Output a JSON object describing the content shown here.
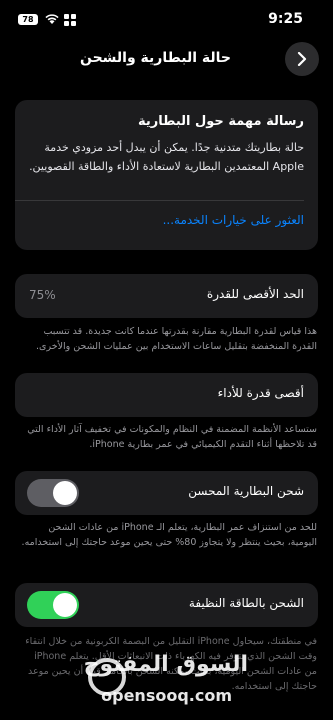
{
  "status_bar": {
    "time": "9:25",
    "battery_level": "78"
  },
  "nav": {
    "title": "حالة البطارية والشحن"
  },
  "message_card": {
    "title": "رسالة مهمة حول البطارية",
    "body": "حالة بطاريتك متدنية جدًا. يمكن أن يبدل أحد مزودي خدمة Apple المعتمدين البطارية لاستعادة الأداء والطاقة القصويين.",
    "link": "العثور على خيارات الخدمة..."
  },
  "max_capacity": {
    "label": "الحد الأقصى للقدرة",
    "value": "75%",
    "footnote": "هذا قياس لقدرة البطارية مقارنة بقدرتها عندما كانت جديدة. قد تتسبب القدرة المنخفضة بتقليل ساعات الاستخدام بين عمليات الشحن والأخرى."
  },
  "peak_performance": {
    "label": "أقصى قدرة للأداء",
    "footnote": "ستساعد الأنظمة المضمنة في النظام والمكونات في تخفيف آثار الأداء التي قد تلاحظها أثناء التقدم الكيميائي في عمر بطارية iPhone."
  },
  "optimized_charging": {
    "label": "شحن البطارية المحسن",
    "enabled": false,
    "footnote": "للحد من استنزاف عمر البطارية، يتعلم الـ iPhone من عادات الشحن اليومية، بحيث ينتظر ولا يتجاوز 80% حتى يحين موعد حاجتك إلى استخدامه."
  },
  "clean_energy_charging": {
    "label": "الشحن بالطاقة النظيفة",
    "enabled": true,
    "footnote": "في منطقتك، سيحاول iPhone التقليل من البصمة الكربونية من خلال انتقاء وقت الشحن الذي تتوفر فيه الكهرباء ذات الانبعاثات الأقل. يتعلم iPhone من عادات الشحن اليومية، بحيث يمكنه الشحن بالكامل قبل أن يحين موعد حاجتك إلى استخدامه."
  },
  "watermark": {
    "arabic": "السوق المفتوح",
    "english": "opensooq.com"
  },
  "colors": {
    "accent": "#0a84ff",
    "toggle_on": "#30d158",
    "toggle_off": "#5e5e63",
    "card_bg": "#1c1c1e"
  }
}
